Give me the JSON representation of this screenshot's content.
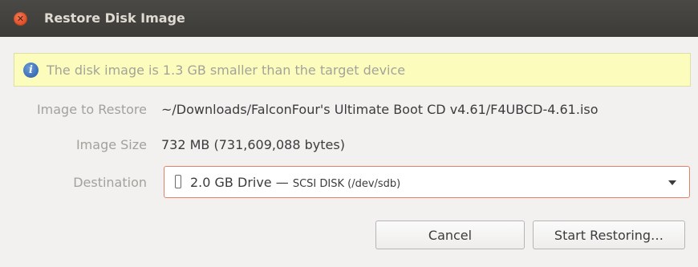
{
  "window": {
    "title": "Restore Disk Image",
    "close_glyph": "✕"
  },
  "info": {
    "icon": "info-icon",
    "message": "The disk image is 1.3 GB smaller than the target device"
  },
  "form": {
    "image_to_restore_label": "Image to Restore",
    "image_to_restore_value": "~/Downloads/FalconFour's Ultimate Boot CD v4.61/F4UBCD-4.61.iso",
    "image_size_label": "Image Size",
    "image_size_value": "732 MB (731,609,088 bytes)",
    "destination_label": "Destination",
    "destination": {
      "drive_name": "2.0 GB Drive",
      "separator": " — ",
      "drive_detail": "SCSI DISK (/dev/sdb)"
    }
  },
  "buttons": {
    "cancel": "Cancel",
    "start": "Start Restoring…"
  },
  "colors": {
    "titlebar": "#3c3b37",
    "close_button": "#e0532b",
    "info_background": "#fcfcbd",
    "dropdown_border": "#e3806a"
  }
}
